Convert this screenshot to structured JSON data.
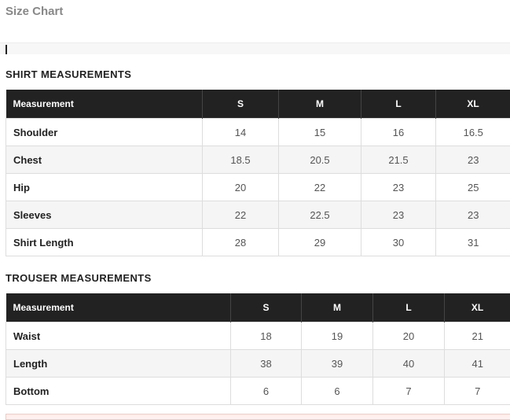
{
  "page": {
    "title": "Size Chart"
  },
  "shirt": {
    "heading": "SHIRT MEASUREMENTS",
    "columns": [
      "Measurement",
      "S",
      "M",
      "L",
      "XL"
    ],
    "rows": [
      {
        "label": "Shoulder",
        "values": [
          "14",
          "15",
          "16",
          "16.5"
        ]
      },
      {
        "label": "Chest",
        "values": [
          "18.5",
          "20.5",
          "21.5",
          "23"
        ]
      },
      {
        "label": "Hip",
        "values": [
          "20",
          "22",
          "23",
          "25"
        ]
      },
      {
        "label": "Sleeves",
        "values": [
          "22",
          "22.5",
          "23",
          "23"
        ]
      },
      {
        "label": "Shirt Length",
        "values": [
          "28",
          "29",
          "30",
          "31"
        ]
      }
    ]
  },
  "trouser": {
    "heading": "TROUSER MEASUREMENTS",
    "columns": [
      "Measurement",
      "S",
      "M",
      "L",
      "XL"
    ],
    "rows": [
      {
        "label": "Waist",
        "values": [
          "18",
          "19",
          "20",
          "21"
        ]
      },
      {
        "label": "Length",
        "values": [
          "38",
          "39",
          "40",
          "41"
        ]
      },
      {
        "label": "Bottom",
        "values": [
          "6",
          "6",
          "7",
          "7"
        ]
      }
    ]
  },
  "colors": {
    "header_bg": "#222222",
    "header_text": "#ffffff",
    "alt_row": "#f5f5f5",
    "title_text": "#888888"
  }
}
